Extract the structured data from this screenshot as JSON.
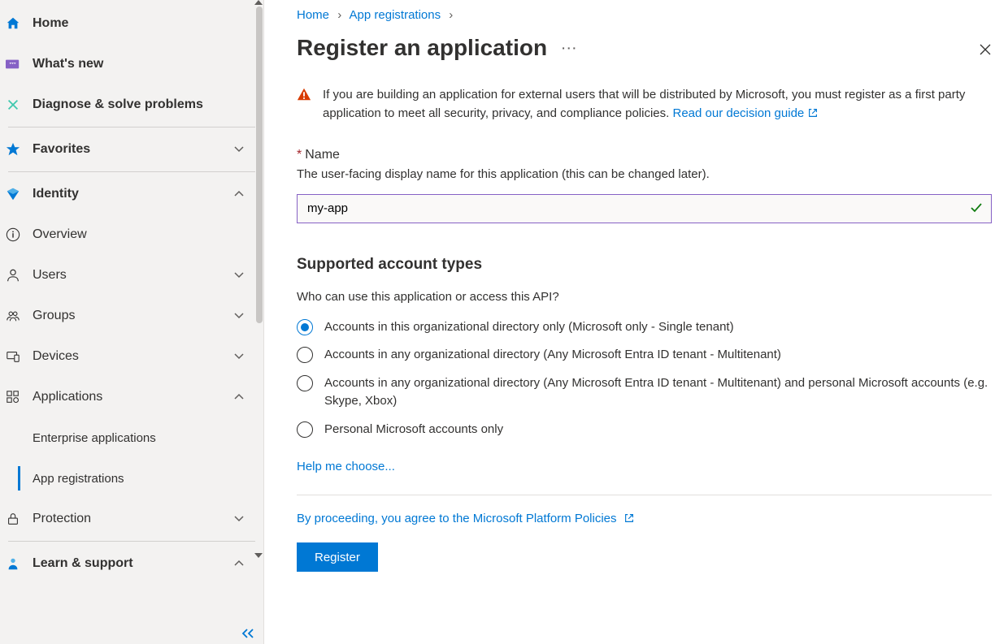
{
  "breadcrumb": {
    "home": "Home",
    "appreg": "App registrations"
  },
  "page_title": "Register an application",
  "warning_text": "If you are building an application for external users that will be distributed by Microsoft, you must register as a first party application to meet all security, privacy, and compliance policies. ",
  "warning_link": "Read our decision guide",
  "name_field": {
    "label": "Name",
    "desc": "The user-facing display name for this application (this can be changed later).",
    "value": "my-app"
  },
  "account_types": {
    "title": "Supported account types",
    "question": "Who can use this application or access this API?",
    "options": [
      "Accounts in this organizational directory only (Microsoft only - Single tenant)",
      "Accounts in any organizational directory (Any Microsoft Entra ID tenant - Multitenant)",
      "Accounts in any organizational directory (Any Microsoft Entra ID tenant - Multitenant) and personal Microsoft accounts (e.g. Skype, Xbox)",
      "Personal Microsoft accounts only"
    ],
    "selected": 0
  },
  "help_link": "Help me choose...",
  "policy_text": "By proceeding, you agree to the Microsoft Platform Policies",
  "register_label": "Register",
  "sidebar": {
    "home": "Home",
    "whatsnew": "What's new",
    "diagnose": "Diagnose & solve problems",
    "favorites": "Favorites",
    "identity": "Identity",
    "overview": "Overview",
    "users": "Users",
    "groups": "Groups",
    "devices": "Devices",
    "applications": "Applications",
    "enterprise_apps": "Enterprise applications",
    "app_registrations": "App registrations",
    "protection": "Protection",
    "learn": "Learn & support"
  }
}
